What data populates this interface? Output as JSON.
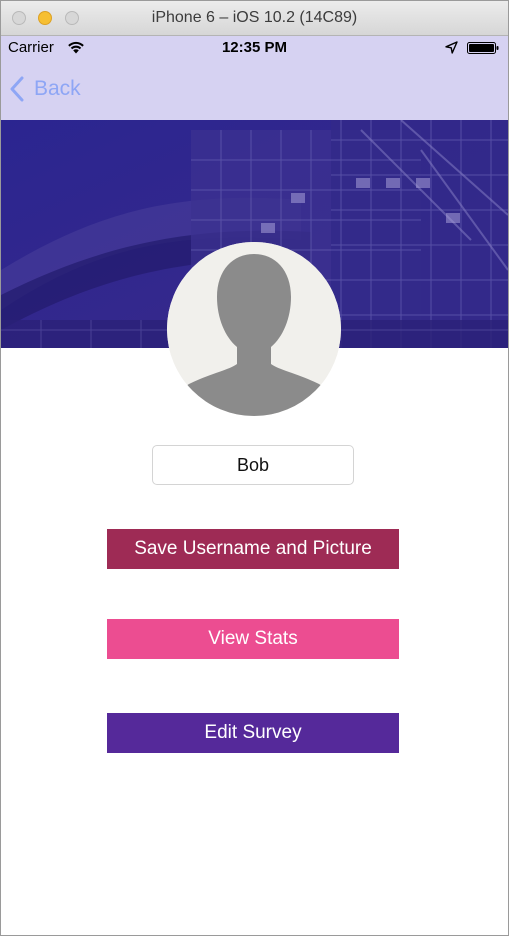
{
  "window": {
    "title": "iPhone 6 – iOS 10.2 (14C89)"
  },
  "status_bar": {
    "carrier": "Carrier",
    "time": "12:35 PM"
  },
  "nav": {
    "back_label": "Back"
  },
  "profile": {
    "username": "Bob"
  },
  "actions": {
    "save_label": "Save Username and Picture",
    "stats_label": "View Stats",
    "survey_label": "Edit Survey"
  },
  "colors": {
    "nav_bar": "#d6d2f2",
    "back_tint": "#8ea6f5",
    "banner": "#2e2483",
    "save_button": "#9e2b55",
    "stats_button": "#ec4d91",
    "survey_button": "#55299a"
  },
  "icons": [
    "wifi-icon",
    "location-arrow-icon",
    "battery-icon",
    "back-chevron-icon",
    "default-avatar-icon"
  ]
}
